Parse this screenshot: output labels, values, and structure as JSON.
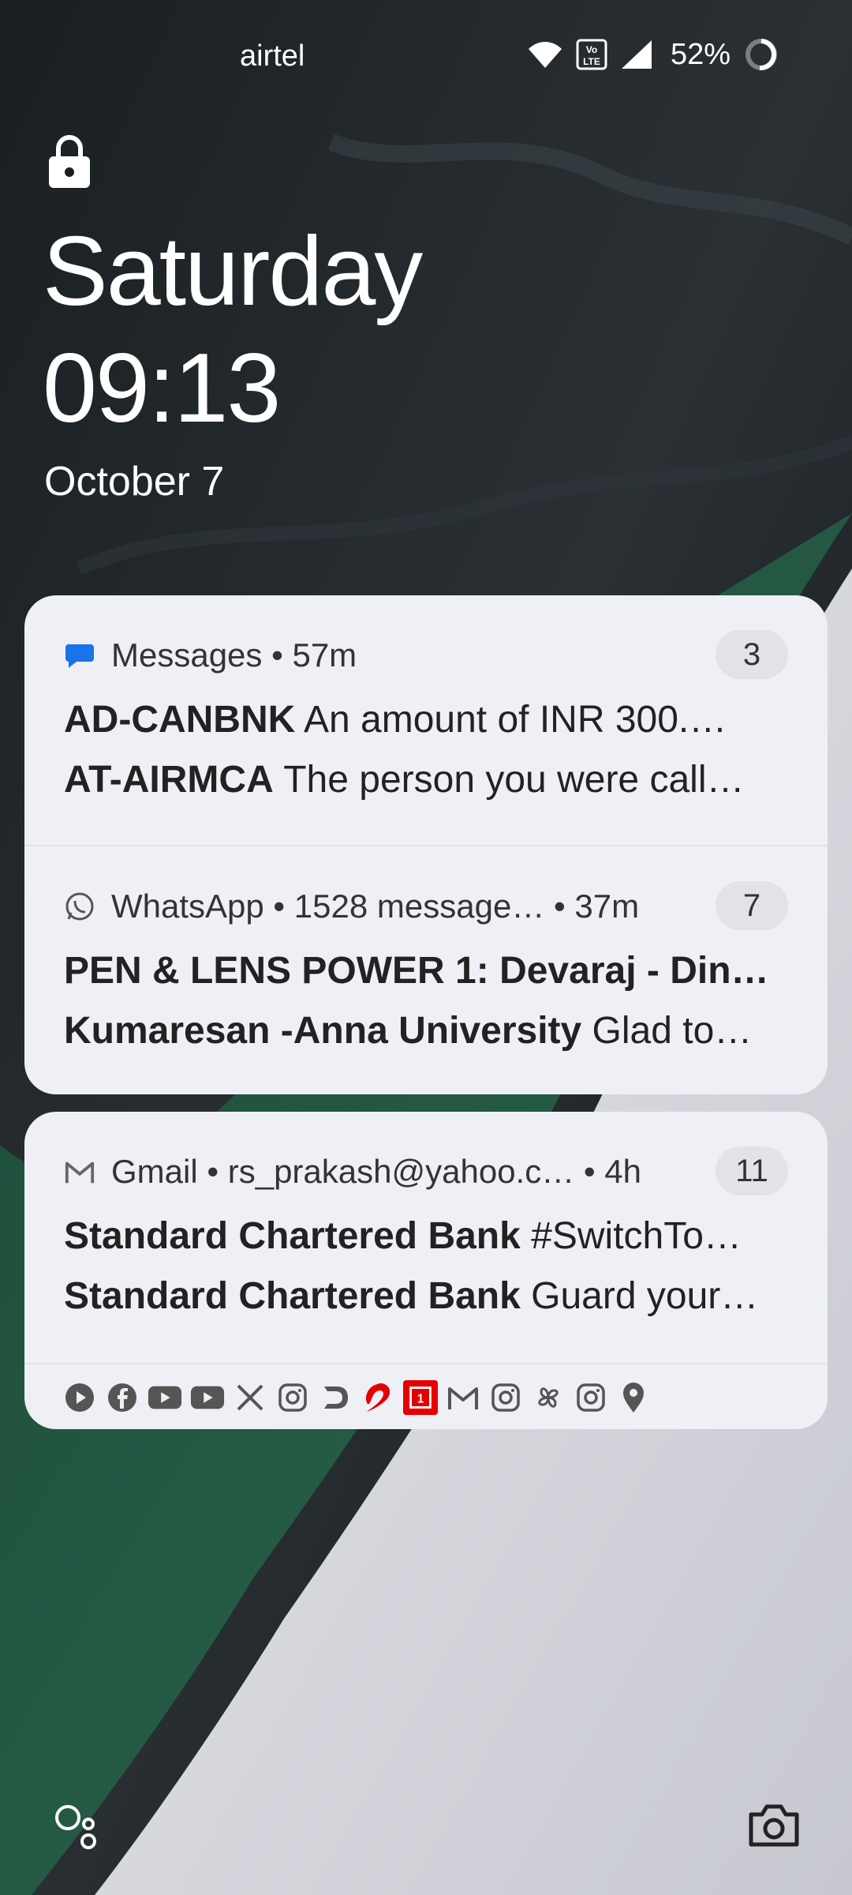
{
  "status_bar": {
    "carrier": "airtel",
    "battery_percent": "52%",
    "icons": [
      "wifi-icon",
      "volte-icon",
      "signal-icon",
      "battery-ring-icon"
    ]
  },
  "lockscreen": {
    "day": "Saturday",
    "time": "09:13",
    "date": "October 7"
  },
  "notifications": [
    {
      "app": "Messages",
      "meta": "Messages • 57m",
      "count": "3",
      "icon": "messages-icon",
      "lines": [
        {
          "sender": "AD-CANBNK",
          "text": " An amount of INR 300.…"
        },
        {
          "sender": "AT-AIRMCA",
          "text": " The person you were call…"
        }
      ]
    },
    {
      "app": "WhatsApp",
      "meta": "WhatsApp • 1528 message… • 37m",
      "count": "7",
      "icon": "whatsapp-icon",
      "lines": [
        {
          "sender": "PEN & LENS POWER 1: Devaraj - Din…",
          "text": ""
        },
        {
          "sender": "Kumaresan -Anna University",
          "text": " Glad to…"
        }
      ]
    },
    {
      "app": "Gmail",
      "meta": "Gmail • rs_prakash@yahoo.c…  • 4h",
      "count": "11",
      "icon": "gmail-icon",
      "lines": [
        {
          "sender": "Standard Chartered Bank",
          "text": " #SwitchTo…"
        },
        {
          "sender": "Standard Chartered Bank",
          "text": " Guard your…"
        }
      ]
    }
  ],
  "shelf_icons": [
    "play-icon",
    "facebook-icon",
    "youtube-icon",
    "youtube-icon",
    "x-icon",
    "instagram-icon",
    "dream11-icon",
    "airtel-icon",
    "oneplus-icon",
    "gmail-icon",
    "instagram-icon",
    "pinwheel-icon",
    "instagram-icon",
    "location-pin-icon"
  ],
  "bottom": {
    "left_icon": "assistant-icon",
    "right_icon": "camera-icon"
  }
}
